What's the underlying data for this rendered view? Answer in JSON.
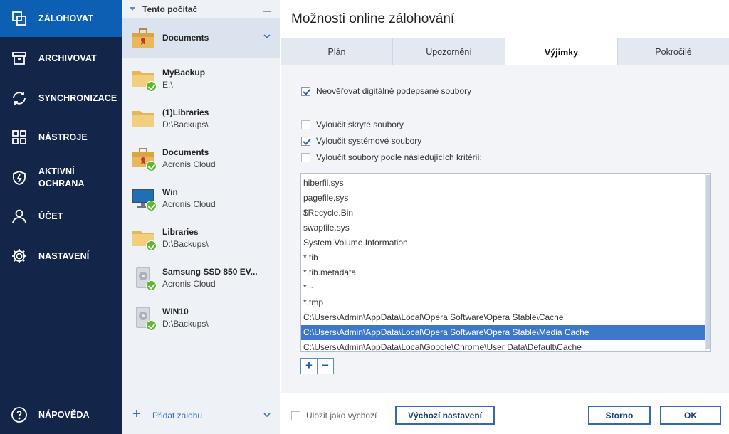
{
  "nav": {
    "items": [
      {
        "label": "ZÁLOHOVAT",
        "icon": "backup-icon"
      },
      {
        "label": "ARCHIVOVAT",
        "icon": "archive-icon"
      },
      {
        "label": "SYNCHRONIZACE",
        "icon": "sync-icon"
      },
      {
        "label": "NÁSTROJE",
        "icon": "tools-grid-icon"
      },
      {
        "label": "AKTIVNÍ OCHRANA",
        "icon": "shield-icon"
      },
      {
        "label": "ÚČET",
        "icon": "user-icon"
      },
      {
        "label": "NASTAVENÍ",
        "icon": "gear-icon"
      }
    ],
    "help": {
      "label": "NÁPOVĚDA",
      "icon": "help-icon"
    }
  },
  "list": {
    "header": "Tento počítač",
    "items": [
      {
        "name": "Documents",
        "sub": "",
        "icon": "briefcase-icon",
        "status": false
      },
      {
        "name": "MyBackup",
        "sub": "E:\\",
        "icon": "folder-icon",
        "status": true
      },
      {
        "name": "(1)Libraries",
        "sub": "D:\\Backups\\",
        "icon": "folder-icon",
        "status": false
      },
      {
        "name": "Documents",
        "sub": "Acronis Cloud",
        "icon": "briefcase-icon",
        "status": true
      },
      {
        "name": "Win",
        "sub": "Acronis Cloud",
        "icon": "monitor-icon",
        "status": true
      },
      {
        "name": "Libraries",
        "sub": "D:\\Backups\\",
        "icon": "folder-icon",
        "status": true
      },
      {
        "name": "Samsung SSD 850 EV...",
        "sub": "Acronis Cloud",
        "icon": "disk-icon",
        "status": true
      },
      {
        "name": "WIN10",
        "sub": "D:\\Backups\\",
        "icon": "disk-icon",
        "status": true
      }
    ],
    "add_label": "Přidat zálohu"
  },
  "dialog": {
    "title": "Možnosti online zálohování",
    "tabs": [
      "Plán",
      "Upozornění",
      "Výjimky",
      "Pokročilé"
    ],
    "active_tab": "Výjimky",
    "options": {
      "no_verify": {
        "label": "Neověřovat digitálně podepsané soubory",
        "checked": true
      },
      "hidden": {
        "label": "Vyloučit skryté soubory",
        "checked": false
      },
      "system": {
        "label": "Vyloučit systémové soubory",
        "checked": true
      },
      "criteria": {
        "label": "Vyloučit soubory podle následujících kritérií:",
        "checked": false
      }
    },
    "exclusions": [
      "hiberfil.sys",
      "pagefile.sys",
      "$Recycle.Bin",
      "swapfile.sys",
      "System Volume Information",
      "*.tib",
      "*.tib.metadata",
      "*.~",
      "*.tmp",
      "C:\\Users\\Admin\\AppData\\Local\\Opera Software\\Opera Stable\\Cache",
      "C:\\Users\\Admin\\AppData\\Local\\Opera Software\\Opera Stable\\Media Cache",
      "C:\\Users\\Admin\\AppData\\Local\\Google\\Chrome\\User Data\\Default\\Cache"
    ],
    "selected_index": 10,
    "add_symbol": "+",
    "remove_symbol": "−",
    "footer": {
      "save_default": {
        "label": "Uložit jako výchozí",
        "checked": false
      },
      "defaults_button": "Výchozí nastavení",
      "cancel_button": "Storno",
      "ok_button": "OK"
    }
  }
}
